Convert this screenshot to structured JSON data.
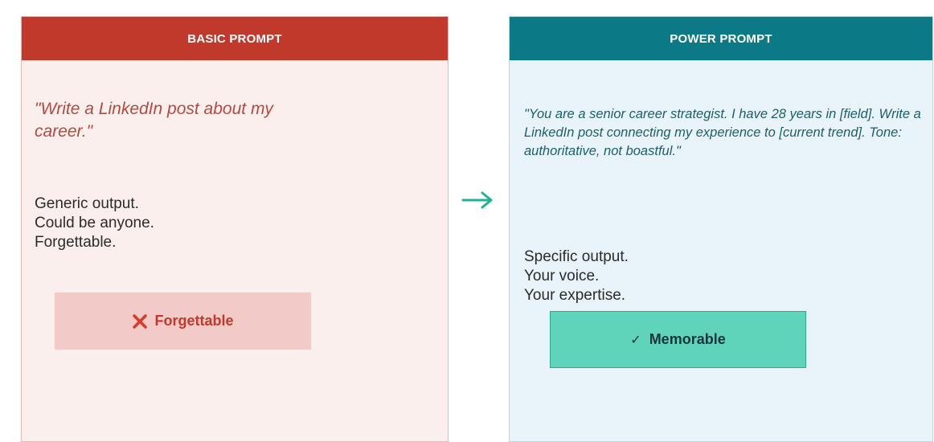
{
  "basic": {
    "header": "BASIC PROMPT",
    "prompt": "\"Write a LinkedIn post about my career.\"",
    "outcomes": [
      "Generic output.",
      "Could be anyone.",
      "Forgettable."
    ],
    "verdict_label": "Forgettable",
    "verdict_icon": "x-icon",
    "accent_color": "#c0392b"
  },
  "power": {
    "header": "POWER PROMPT",
    "prompt": "\"You are a senior career strategist. I have 28 years in [field]. Write a LinkedIn post connecting my experience to [current trend]. Tone: authoritative, not boastful.\"",
    "outcomes": [
      "Specific output.",
      "Your voice.",
      "Your expertise."
    ],
    "verdict_label": "Memorable",
    "verdict_icon": "check-icon",
    "accent_color": "#0b7a86"
  },
  "connector": {
    "icon": "right-arrow-icon",
    "color": "#1fb394"
  }
}
